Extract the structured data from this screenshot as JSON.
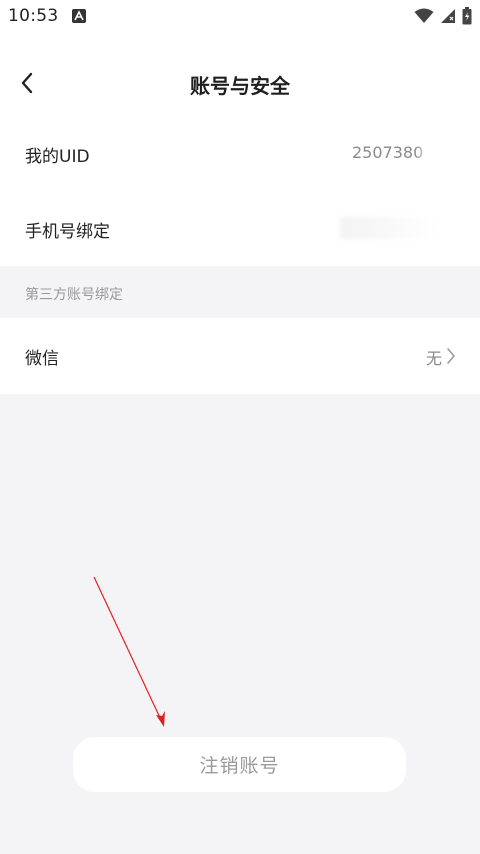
{
  "status_bar": {
    "time": "10:53",
    "icons": [
      "notification-a-icon",
      "wifi-icon",
      "signal-icon",
      "battery-icon"
    ]
  },
  "nav": {
    "title": "账号与安全",
    "back_icon": "chevron-left-icon"
  },
  "rows": {
    "uid": {
      "label": "我的UID",
      "value": "2507380"
    },
    "phone": {
      "label": "手机号绑定",
      "value": ""
    }
  },
  "third_party": {
    "section_title": "第三方账号绑定",
    "wechat": {
      "label": "微信",
      "value": "无",
      "icon": "chevron-right-icon"
    }
  },
  "cancel_account": {
    "label": "注销账号"
  },
  "colors": {
    "background": "#f4f4f7",
    "card": "#ffffff",
    "annotation_arrow": "#e02020"
  }
}
